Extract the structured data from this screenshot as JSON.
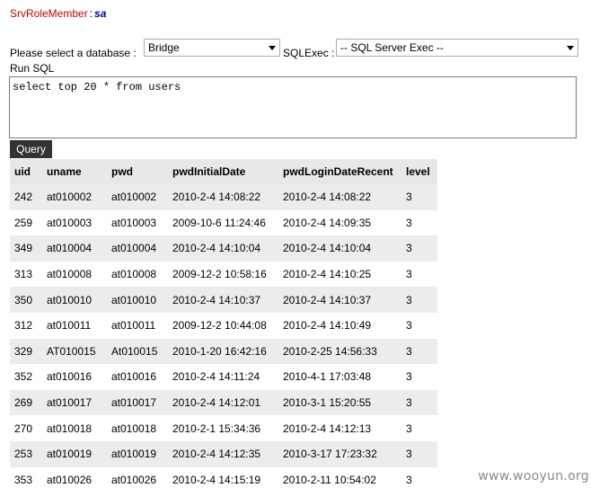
{
  "role": {
    "label": "SrvRoleMember",
    "separator": ":",
    "value": "sa"
  },
  "form": {
    "database_label": "Please select a database :",
    "database_value": "Bridge",
    "sqlexec_label": "SQLExec :",
    "sqlexec_value": "-- SQL Server Exec --",
    "runsql_label": "Run SQL",
    "sql_text": "select top 20 * from users",
    "query_button": "Query"
  },
  "table": {
    "headers": [
      "uid",
      "uname",
      "pwd",
      "pwdInitialDate",
      "pwdLoginDateRecent",
      "level"
    ],
    "rows": [
      [
        "242",
        "at010002",
        "at010002",
        "2010-2-4 14:08:22",
        "2010-2-4 14:08:22",
        "3"
      ],
      [
        "259",
        "at010003",
        "at010003",
        "2009-10-6 11:24:46",
        "2010-2-4 14:09:35",
        "3"
      ],
      [
        "349",
        "at010004",
        "at010004",
        "2010-2-4 14:10:04",
        "2010-2-4 14:10:04",
        "3"
      ],
      [
        "313",
        "at010008",
        "at010008",
        "2009-12-2 10:58:16",
        "2010-2-4 14:10:25",
        "3"
      ],
      [
        "350",
        "at010010",
        "at010010",
        "2010-2-4 14:10:37",
        "2010-2-4 14:10:37",
        "3"
      ],
      [
        "312",
        "at010011",
        "at010011",
        "2009-12-2 10:44:08",
        "2010-2-4 14:10:49",
        "3"
      ],
      [
        "329",
        "AT010015",
        "At010015",
        "2010-1-20 16:42:16",
        "2010-2-25 14:56:33",
        "3"
      ],
      [
        "352",
        "at010016",
        "at010016",
        "2010-2-4 14:11:24",
        "2010-4-1 17:03:48",
        "3"
      ],
      [
        "269",
        "at010017",
        "at010017",
        "2010-2-4 14:12:01",
        "2010-3-1 15:20:55",
        "3"
      ],
      [
        "270",
        "at010018",
        "at010018",
        "2010-2-1 15:34:36",
        "2010-2-4 14:12:13",
        "3"
      ],
      [
        "253",
        "at010019",
        "at010019",
        "2010-2-4 14:12:35",
        "2010-3-17 17:23:32",
        "3"
      ],
      [
        "353",
        "at010026",
        "at010026",
        "2010-2-4 14:15:19",
        "2010-2-11 10:54:02",
        "3"
      ]
    ]
  },
  "watermark": "www.wooyun.org",
  "colors": {
    "role_label": "#cc0000",
    "role_value": "#000099",
    "button_bg": "#333333",
    "row_alt": "#ececec"
  }
}
